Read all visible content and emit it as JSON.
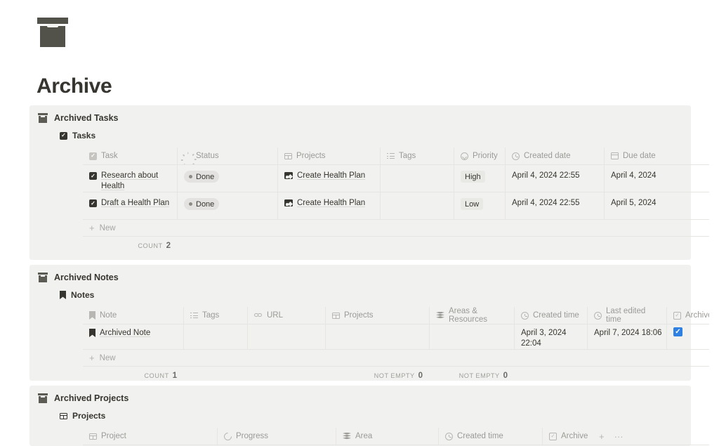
{
  "page": {
    "icon": "archive-box-icon",
    "title": "Archive"
  },
  "sections": [
    {
      "id": "archived-tasks",
      "heading": "Archived Tasks",
      "database": {
        "label": "Tasks",
        "icon": "checkbox-icon"
      },
      "columns": [
        {
          "label": "Task",
          "icon": "checkbox-icon"
        },
        {
          "label": "Status",
          "icon": "status-spinner-icon"
        },
        {
          "label": "Projects",
          "icon": "grid-icon"
        },
        {
          "label": "Tags",
          "icon": "list-icon"
        },
        {
          "label": "Priority",
          "icon": "select-icon"
        },
        {
          "label": "Created date",
          "icon": "clock-icon"
        },
        {
          "label": "Due date",
          "icon": "calendar-icon"
        }
      ],
      "rows": [
        {
          "task": "Research about Health",
          "status": "Done",
          "projects": "Create Health Plan",
          "tags": "",
          "priority": "High",
          "created_date": "April 4, 2024 22:55",
          "due_date": "April 4, 2024"
        },
        {
          "task": "Draft a Health Plan",
          "status": "Done",
          "projects": "Create Health Plan",
          "tags": "",
          "priority": "Low",
          "created_date": "April 4, 2024 22:55",
          "due_date": "April 5, 2024"
        }
      ],
      "new_row_label": "New",
      "footer": [
        {
          "col": 0,
          "label": "COUNT",
          "value": "2"
        }
      ]
    },
    {
      "id": "archived-notes",
      "heading": "Archived Notes",
      "database": {
        "label": "Notes",
        "icon": "bookmark-icon"
      },
      "columns": [
        {
          "label": "Note",
          "icon": "bookmark-icon"
        },
        {
          "label": "Tags",
          "icon": "list-icon"
        },
        {
          "label": "URL",
          "icon": "link-icon"
        },
        {
          "label": "Projects",
          "icon": "grid-icon"
        },
        {
          "label": "Areas & Resources",
          "icon": "layers-icon"
        },
        {
          "label": "Created time",
          "icon": "clock-icon"
        },
        {
          "label": "Last edited time",
          "icon": "clock-icon"
        },
        {
          "label": "Archive",
          "icon": "checkbox-outline-icon"
        }
      ],
      "rows": [
        {
          "note": "Archived Note",
          "tags": "",
          "url": "",
          "projects": "",
          "areas_resources": "",
          "created_time": "April 3, 2024 22:04",
          "last_edited_time": "April 7, 2024 18:06",
          "archive_checked": true
        }
      ],
      "new_row_label": "New",
      "footer": [
        {
          "col": 0,
          "label": "COUNT",
          "value": "1"
        },
        {
          "col": 3,
          "label": "NOT EMPTY",
          "value": "0"
        },
        {
          "col": 4,
          "label": "NOT EMPTY",
          "value": "0"
        }
      ]
    },
    {
      "id": "archived-projects",
      "heading": "Archived Projects",
      "database": {
        "label": "Projects",
        "icon": "grid-icon"
      },
      "columns": [
        {
          "label": "Project",
          "icon": "grid-icon"
        },
        {
          "label": "Progress",
          "icon": "progress-icon"
        },
        {
          "label": "Area",
          "icon": "layers-icon"
        },
        {
          "label": "Created time",
          "icon": "clock-icon"
        },
        {
          "label": "Archive",
          "icon": "checkbox-outline-icon"
        }
      ],
      "add_column_label": "+",
      "more_options_label": "···",
      "rows": []
    }
  ],
  "colors": {
    "page_background": "#ffffff",
    "section_background": "#f1f1ef",
    "text_primary": "#37352f",
    "text_muted": "#9b9a97",
    "border": "#e6e5e2",
    "checkbox_blue": "#2f80e3",
    "badge_background": "#e3e2e0",
    "icon_dark": "#52524a"
  }
}
